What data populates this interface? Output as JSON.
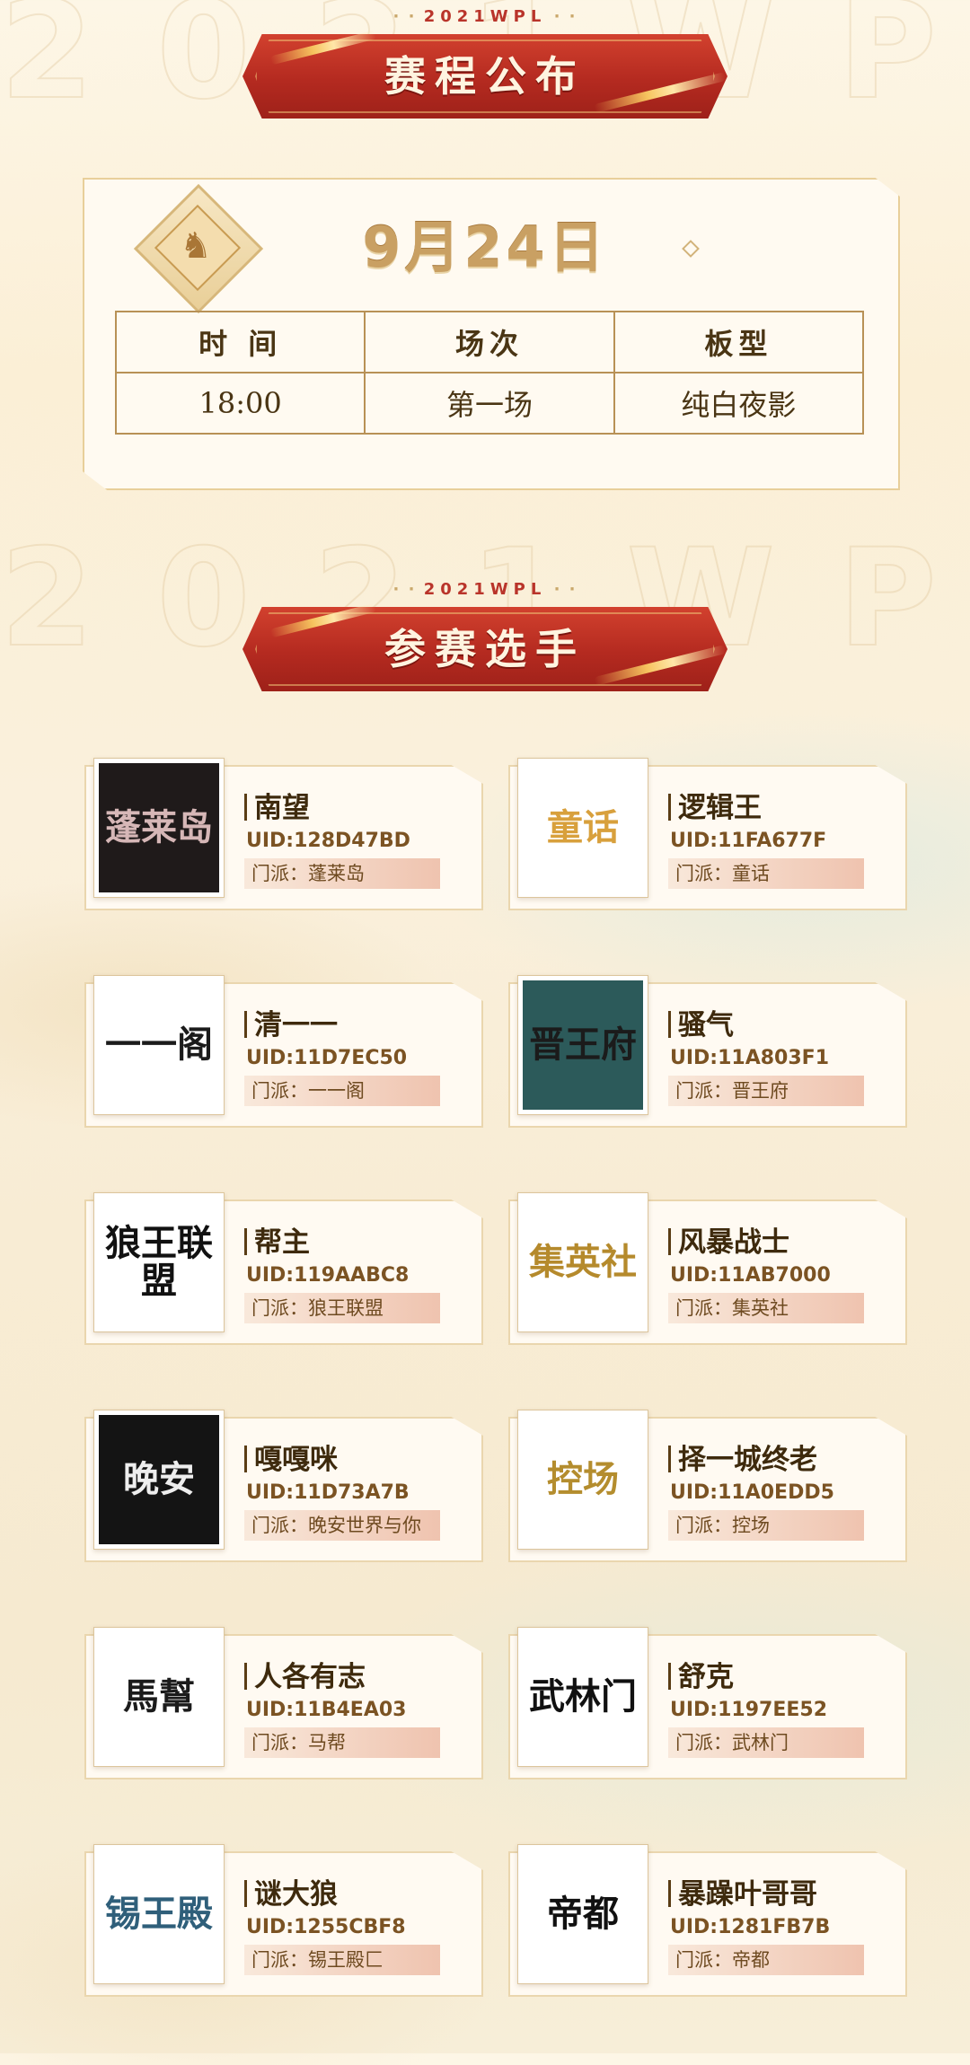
{
  "header_tag": "2021WPL",
  "sections": {
    "schedule_title": "赛程公布",
    "players_title": "参赛选手"
  },
  "schedule": {
    "date": "9月24日",
    "headers": [
      "时 间",
      "场次",
      "板型"
    ],
    "rows": [
      [
        "18:00",
        "第一场",
        "纯白夜影"
      ]
    ]
  },
  "players": [
    {
      "name": "南望",
      "uid": "UID:128D47BD",
      "sect": "门派：蓬莱岛",
      "logo_text": "蓬莱岛",
      "logo_bg": "#1f1a1a",
      "logo_color": "#d6b7b7"
    },
    {
      "name": "逻辑王",
      "uid": "UID:11FA677F",
      "sect": "门派：童话",
      "logo_text": "童话",
      "logo_bg": "#ffffff",
      "logo_color": "#d8a03c"
    },
    {
      "name": "清一一",
      "uid": "UID:11D7EC50",
      "sect": "门派：一一阁",
      "logo_text": "一一阁",
      "logo_bg": "#ffffff",
      "logo_color": "#1b1b1b"
    },
    {
      "name": "骚气",
      "uid": "UID:11A803F1",
      "sect": "门派：晋王府",
      "logo_text": "晋王府",
      "logo_bg": "#2c5a5a",
      "logo_color": "#1b1b1b"
    },
    {
      "name": "帮主",
      "uid": "UID:119AABC8",
      "sect": "门派：狼王联盟",
      "logo_text": "狼王联盟",
      "logo_bg": "#ffffff",
      "logo_color": "#111111"
    },
    {
      "name": "风暴战士",
      "uid": "UID:11AB7000",
      "sect": "门派：集英社",
      "logo_text": "集英社",
      "logo_bg": "#ffffff",
      "logo_color": "#b58a2c"
    },
    {
      "name": "嘎嘎咪",
      "uid": "UID:11D73A7B",
      "sect": "门派：晚安世界与你",
      "logo_text": "晚安",
      "logo_bg": "#141414",
      "logo_color": "#eeeeee"
    },
    {
      "name": "择一城终老",
      "uid": "UID:11A0EDD5",
      "sect": "门派：控场",
      "logo_text": "控场",
      "logo_bg": "#ffffff",
      "logo_color": "#b48d2e"
    },
    {
      "name": "人各有志",
      "uid": "UID:11B4EA03",
      "sect": "门派：马帮",
      "logo_text": "馬幫",
      "logo_bg": "#ffffff",
      "logo_color": "#1b1b1b"
    },
    {
      "name": "舒克",
      "uid": "UID:1197EE52",
      "sect": "门派：武林门",
      "logo_text": "武林门",
      "logo_bg": "#ffffff",
      "logo_color": "#111111"
    },
    {
      "name": "谜大狼",
      "uid": "UID:1255CBF8",
      "sect": "门派：锡王殿匚",
      "logo_text": "锡王殿",
      "logo_bg": "#ffffff",
      "logo_color": "#2f5f7a"
    },
    {
      "name": "暴躁叶哥哥",
      "uid": "UID:1281FB7B",
      "sect": "门派：帝都",
      "logo_text": "帝都",
      "logo_bg": "#ffffff",
      "logo_color": "#111111"
    }
  ]
}
